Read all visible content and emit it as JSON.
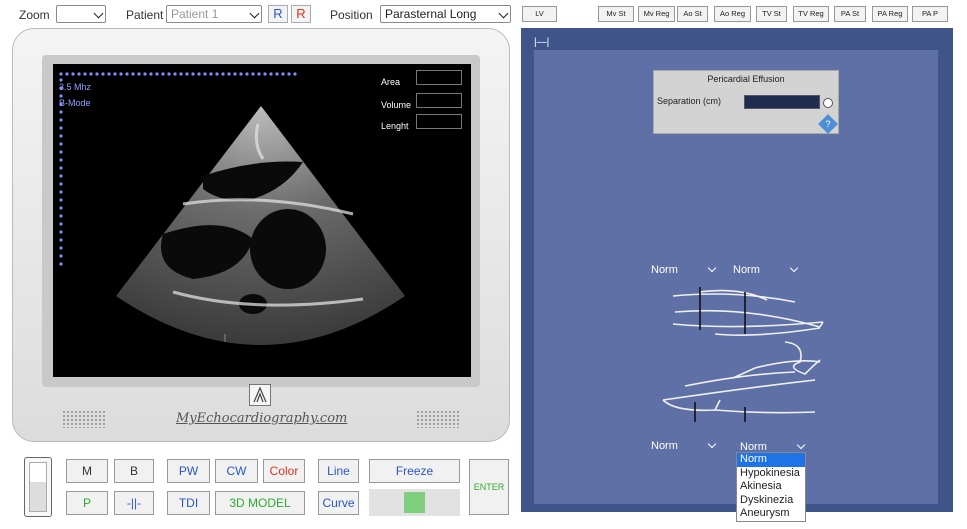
{
  "toolbar": {
    "zoom_label": "Zoom",
    "zoom_value": "",
    "patient_label": "Patient",
    "patient_value": "Patient 1",
    "r_blue": "R",
    "r_red": "R",
    "position_label": "Position",
    "position_value": "Parasternal Long",
    "lv_button": "LV",
    "view_buttons": [
      "Mv St",
      "Mv Reg",
      "Ao St",
      "Ao Reg",
      "TV St",
      "TV Reg",
      "PA St",
      "PA Reg",
      "PA P"
    ]
  },
  "screen": {
    "freq": "3.5 Mhz",
    "mode": "B-Mode",
    "area_label": "Area",
    "volume_label": "Volume",
    "length_label": "Lenght",
    "brand": "MyEchocardiography.com"
  },
  "controls": {
    "m": "M",
    "b": "B",
    "pw": "PW",
    "cw": "CW",
    "color": "Color",
    "line": "Line",
    "freeze": "Freeze",
    "enter": "ENTER",
    "p": "P",
    "caliper": "-||-",
    "tdi": "TDI",
    "model3d": "3D MODEL",
    "curve": "Curve"
  },
  "panel": {
    "corner_icon": "|—|",
    "pe_title": "Pericardial Effusion",
    "separation_label": "Separation (cm)",
    "help": "?",
    "wall_selects": [
      "Norm",
      "Norm",
      "Norm",
      "Norm"
    ],
    "options": [
      "Norm",
      "Hypokinesia",
      "Akinesia",
      "Dyskinezia",
      "Aneurysm"
    ],
    "colors": {
      "panel": "#3f5488",
      "inner": "#5e70a6",
      "highlight": "#1e73e6"
    }
  }
}
